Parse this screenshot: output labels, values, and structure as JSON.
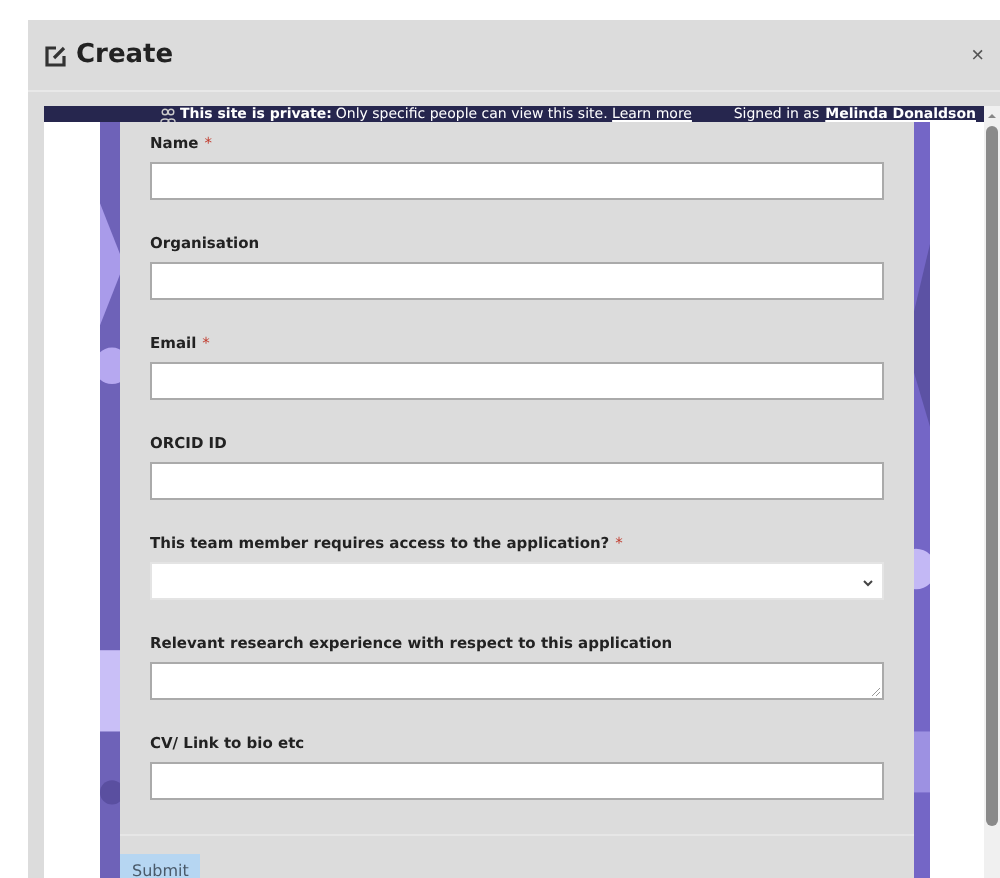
{
  "dialog": {
    "title": "Create",
    "close": "×"
  },
  "banner": {
    "bold": "This site is private:",
    "text": "Only specific people can view this site.",
    "link": "Learn more",
    "signed_in": "Signed in as",
    "user": "Melinda Donaldson"
  },
  "fields": [
    {
      "label": "Name",
      "required_mark": "*",
      "kind": "text"
    },
    {
      "label": "Organisation",
      "kind": "text"
    },
    {
      "label": "Email",
      "required_mark": "*",
      "kind": "text"
    },
    {
      "label": "ORCID ID",
      "kind": "text"
    },
    {
      "label": "This team member requires access to the application?",
      "required_mark": "*",
      "kind": "select"
    },
    {
      "label": "Relevant research experience with respect to this application",
      "kind": "textarea"
    },
    {
      "label": "CV/ Link to bio etc",
      "kind": "text"
    }
  ],
  "submit": "Submit"
}
